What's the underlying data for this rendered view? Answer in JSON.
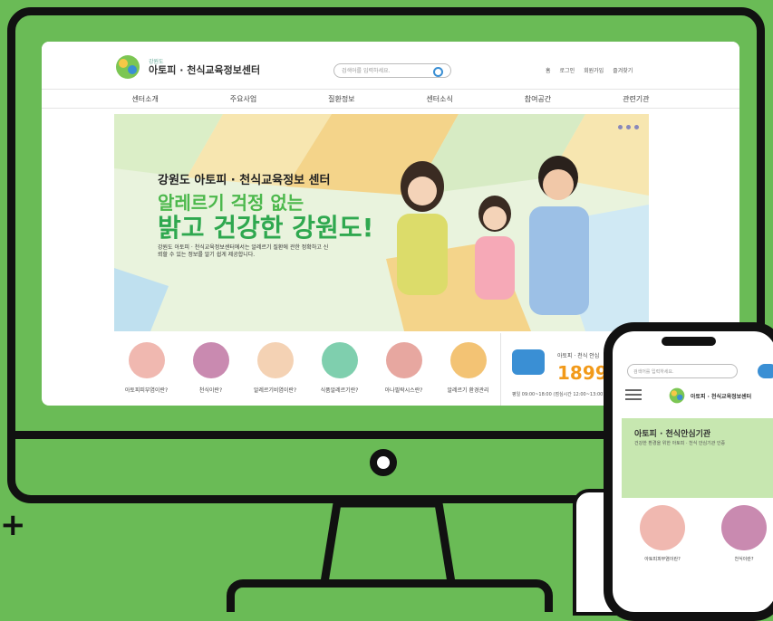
{
  "site": {
    "logo_small": "강원도",
    "logo_name": "아토피 · 천식교육정보센터",
    "search_placeholder": "검색어를 입력하세요.",
    "utils": [
      "홈",
      "로그인",
      "회원가입",
      "즐겨찾기"
    ],
    "nav": [
      "센터소개",
      "주요사업",
      "질환정보",
      "센터소식",
      "참여공간",
      "관련기관"
    ]
  },
  "hero": {
    "title": "강원도 아토피 · 천식교육정보 센터",
    "headline_top": "알레르기 걱정 없는",
    "headline_main": "밝고 건강한 강원도!",
    "desc": "강원도 아토피 · 천식교육정보센터에서는 알레르기 질환에 관한 정확하고 신뢰할 수 있는 정보를 알기 쉽게 제공합니다."
  },
  "quick_links": [
    {
      "label": "아토피피부염이란?",
      "color": "#f0b8b0"
    },
    {
      "label": "천식이란?",
      "color": "#c98ab0"
    },
    {
      "label": "알레르기비염이란?",
      "color": "#f4d2b4"
    },
    {
      "label": "식품알레르기란?",
      "color": "#7fcfae"
    },
    {
      "label": "아나필락시스란?",
      "color": "#e7a7a0"
    },
    {
      "label": "알레르기 환경관리",
      "color": "#f3c374"
    }
  ],
  "call": {
    "title": "아토피 · 천식 안심",
    "number": "1899-",
    "note": "평일 09:00~18:00 (점심시간 12:00~13:00)"
  },
  "mobile": {
    "search_placeholder": "검색어를 입력하세요.",
    "logo_name": "아토피 · 천식교육정보센터",
    "banner_title": "아토피 · 천식안심기관",
    "banner_sub": "건강한 환경을 위한 아토피 · 천식 안심기관 인증",
    "icons": [
      "아토피피부염이란?",
      "천식이란?"
    ]
  },
  "colors": {
    "background": "#6abb56",
    "accent": "#2fa84f",
    "call": "#f29a1a"
  }
}
